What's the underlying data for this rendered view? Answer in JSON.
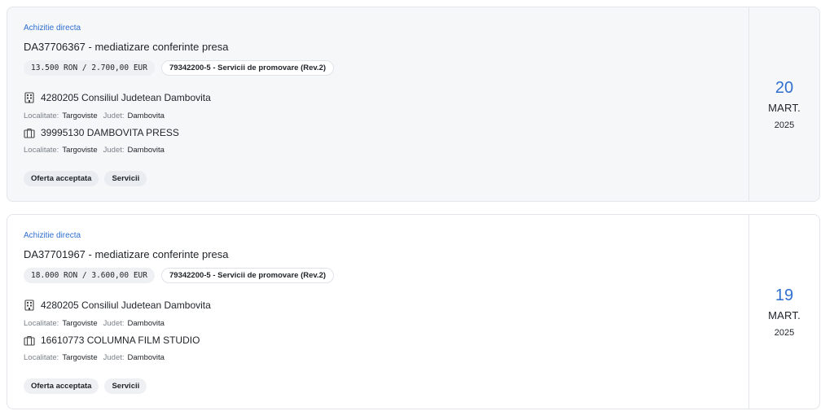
{
  "items": [
    {
      "procedure_type": "Achizitie directa",
      "title": "DA37706367 - mediatizare conferinte presa",
      "price": "13.500 RON / 2.700,00 EUR",
      "cpv": "79342200-5 - Servicii de promovare (Rev.2)",
      "authority": "4280205 Consiliul Judetean Dambovita",
      "authority_locality_label": "Localitate:",
      "authority_locality": "Targoviste",
      "authority_county_label": "Judet:",
      "authority_county": "Dambovita",
      "supplier": "39995130 DAMBOVITA PRESS",
      "supplier_locality_label": "Localitate:",
      "supplier_locality": "Targoviste",
      "supplier_county_label": "Judet:",
      "supplier_county": "Dambovita",
      "tags": [
        "Oferta acceptata",
        "Servicii"
      ],
      "date": {
        "day": "20",
        "month": "MART.",
        "year": "2025"
      },
      "icons": {
        "authority": "building-icon",
        "supplier": "briefcase-icon"
      }
    },
    {
      "procedure_type": "Achizitie directa",
      "title": "DA37701967 - mediatizare conferinte presa",
      "price": "18.000 RON / 3.600,00 EUR",
      "cpv": "79342200-5 - Servicii de promovare (Rev.2)",
      "authority": "4280205 Consiliul Judetean Dambovita",
      "authority_locality_label": "Localitate:",
      "authority_locality": "Targoviste",
      "authority_county_label": "Judet:",
      "authority_county": "Dambovita",
      "supplier": "16610773 COLUMNA FILM STUDIO",
      "supplier_locality_label": "Localitate:",
      "supplier_locality": "Targoviste",
      "supplier_county_label": "Judet:",
      "supplier_county": "Dambovita",
      "tags": [
        "Oferta acceptata",
        "Servicii"
      ],
      "date": {
        "day": "19",
        "month": "MART.",
        "year": "2025"
      },
      "icons": {
        "authority": "building-icon",
        "supplier": "briefcase-icon"
      }
    }
  ],
  "colors": {
    "accent": "#2f6fd0",
    "card_bg_highlight": "#f6f7f9",
    "border": "#e3e6ea"
  }
}
